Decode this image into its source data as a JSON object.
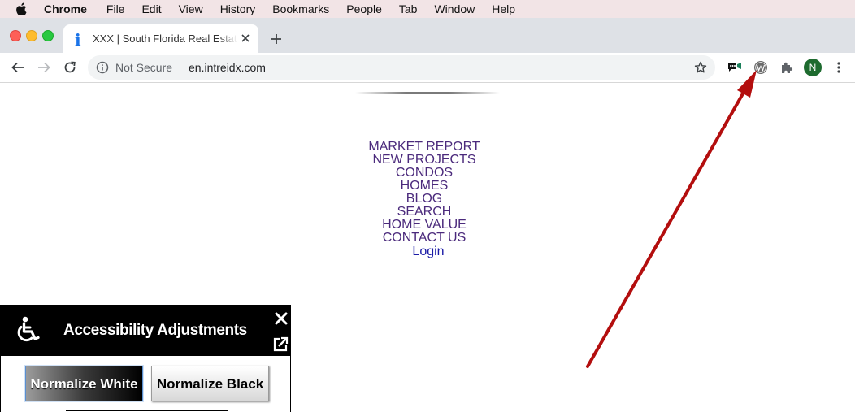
{
  "menubar": {
    "app": "Chrome",
    "items": [
      "File",
      "Edit",
      "View",
      "History",
      "Bookmarks",
      "People",
      "Tab",
      "Window",
      "Help"
    ]
  },
  "tab": {
    "title": "XXX | South Florida Real Estate",
    "favicon": "info-i-icon"
  },
  "toolbar": {
    "security_label": "Not Secure",
    "url": "en.intreidx.com",
    "profile_initial": "N"
  },
  "nav": {
    "items": [
      "MARKET REPORT",
      "NEW PROJECTS",
      "CONDOS",
      "HOMES",
      "BLOG",
      "SEARCH",
      "HOME VALUE",
      "CONTACT US"
    ],
    "login": "Login",
    "link_color": "#4b2a7c"
  },
  "accessibility": {
    "title": "Accessibility Adjustments",
    "normalize_white": "Normalize White",
    "normalize_black": "Normalize Black"
  },
  "colors": {
    "arrow": "#b30e0e",
    "menubar_bg": "#f2e4e6",
    "tabstrip_bg": "#dee1e6"
  }
}
